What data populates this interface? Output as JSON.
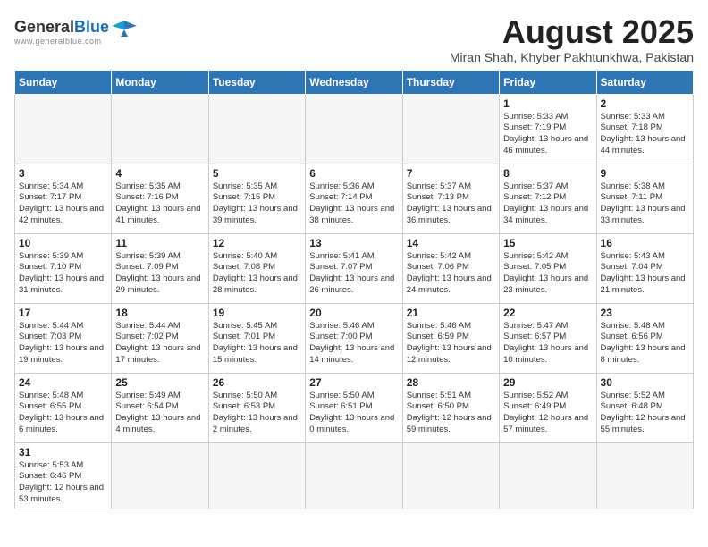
{
  "header": {
    "title": "August 2025",
    "subtitle": "Miran Shah, Khyber Pakhtunkhwa, Pakistan",
    "logo_general": "General",
    "logo_blue": "Blue"
  },
  "weekdays": [
    "Sunday",
    "Monday",
    "Tuesday",
    "Wednesday",
    "Thursday",
    "Friday",
    "Saturday"
  ],
  "weeks": [
    [
      {
        "day": "",
        "info": ""
      },
      {
        "day": "",
        "info": ""
      },
      {
        "day": "",
        "info": ""
      },
      {
        "day": "",
        "info": ""
      },
      {
        "day": "",
        "info": ""
      },
      {
        "day": "1",
        "info": "Sunrise: 5:33 AM\nSunset: 7:19 PM\nDaylight: 13 hours and 46 minutes."
      },
      {
        "day": "2",
        "info": "Sunrise: 5:33 AM\nSunset: 7:18 PM\nDaylight: 13 hours and 44 minutes."
      }
    ],
    [
      {
        "day": "3",
        "info": "Sunrise: 5:34 AM\nSunset: 7:17 PM\nDaylight: 13 hours and 42 minutes."
      },
      {
        "day": "4",
        "info": "Sunrise: 5:35 AM\nSunset: 7:16 PM\nDaylight: 13 hours and 41 minutes."
      },
      {
        "day": "5",
        "info": "Sunrise: 5:35 AM\nSunset: 7:15 PM\nDaylight: 13 hours and 39 minutes."
      },
      {
        "day": "6",
        "info": "Sunrise: 5:36 AM\nSunset: 7:14 PM\nDaylight: 13 hours and 38 minutes."
      },
      {
        "day": "7",
        "info": "Sunrise: 5:37 AM\nSunset: 7:13 PM\nDaylight: 13 hours and 36 minutes."
      },
      {
        "day": "8",
        "info": "Sunrise: 5:37 AM\nSunset: 7:12 PM\nDaylight: 13 hours and 34 minutes."
      },
      {
        "day": "9",
        "info": "Sunrise: 5:38 AM\nSunset: 7:11 PM\nDaylight: 13 hours and 33 minutes."
      }
    ],
    [
      {
        "day": "10",
        "info": "Sunrise: 5:39 AM\nSunset: 7:10 PM\nDaylight: 13 hours and 31 minutes."
      },
      {
        "day": "11",
        "info": "Sunrise: 5:39 AM\nSunset: 7:09 PM\nDaylight: 13 hours and 29 minutes."
      },
      {
        "day": "12",
        "info": "Sunrise: 5:40 AM\nSunset: 7:08 PM\nDaylight: 13 hours and 28 minutes."
      },
      {
        "day": "13",
        "info": "Sunrise: 5:41 AM\nSunset: 7:07 PM\nDaylight: 13 hours and 26 minutes."
      },
      {
        "day": "14",
        "info": "Sunrise: 5:42 AM\nSunset: 7:06 PM\nDaylight: 13 hours and 24 minutes."
      },
      {
        "day": "15",
        "info": "Sunrise: 5:42 AM\nSunset: 7:05 PM\nDaylight: 13 hours and 23 minutes."
      },
      {
        "day": "16",
        "info": "Sunrise: 5:43 AM\nSunset: 7:04 PM\nDaylight: 13 hours and 21 minutes."
      }
    ],
    [
      {
        "day": "17",
        "info": "Sunrise: 5:44 AM\nSunset: 7:03 PM\nDaylight: 13 hours and 19 minutes."
      },
      {
        "day": "18",
        "info": "Sunrise: 5:44 AM\nSunset: 7:02 PM\nDaylight: 13 hours and 17 minutes."
      },
      {
        "day": "19",
        "info": "Sunrise: 5:45 AM\nSunset: 7:01 PM\nDaylight: 13 hours and 15 minutes."
      },
      {
        "day": "20",
        "info": "Sunrise: 5:46 AM\nSunset: 7:00 PM\nDaylight: 13 hours and 14 minutes."
      },
      {
        "day": "21",
        "info": "Sunrise: 5:46 AM\nSunset: 6:59 PM\nDaylight: 13 hours and 12 minutes."
      },
      {
        "day": "22",
        "info": "Sunrise: 5:47 AM\nSunset: 6:57 PM\nDaylight: 13 hours and 10 minutes."
      },
      {
        "day": "23",
        "info": "Sunrise: 5:48 AM\nSunset: 6:56 PM\nDaylight: 13 hours and 8 minutes."
      }
    ],
    [
      {
        "day": "24",
        "info": "Sunrise: 5:48 AM\nSunset: 6:55 PM\nDaylight: 13 hours and 6 minutes."
      },
      {
        "day": "25",
        "info": "Sunrise: 5:49 AM\nSunset: 6:54 PM\nDaylight: 13 hours and 4 minutes."
      },
      {
        "day": "26",
        "info": "Sunrise: 5:50 AM\nSunset: 6:53 PM\nDaylight: 13 hours and 2 minutes."
      },
      {
        "day": "27",
        "info": "Sunrise: 5:50 AM\nSunset: 6:51 PM\nDaylight: 13 hours and 0 minutes."
      },
      {
        "day": "28",
        "info": "Sunrise: 5:51 AM\nSunset: 6:50 PM\nDaylight: 12 hours and 59 minutes."
      },
      {
        "day": "29",
        "info": "Sunrise: 5:52 AM\nSunset: 6:49 PM\nDaylight: 12 hours and 57 minutes."
      },
      {
        "day": "30",
        "info": "Sunrise: 5:52 AM\nSunset: 6:48 PM\nDaylight: 12 hours and 55 minutes."
      }
    ],
    [
      {
        "day": "31",
        "info": "Sunrise: 5:53 AM\nSunset: 6:46 PM\nDaylight: 12 hours and 53 minutes."
      },
      {
        "day": "",
        "info": ""
      },
      {
        "day": "",
        "info": ""
      },
      {
        "day": "",
        "info": ""
      },
      {
        "day": "",
        "info": ""
      },
      {
        "day": "",
        "info": ""
      },
      {
        "day": "",
        "info": ""
      }
    ]
  ]
}
